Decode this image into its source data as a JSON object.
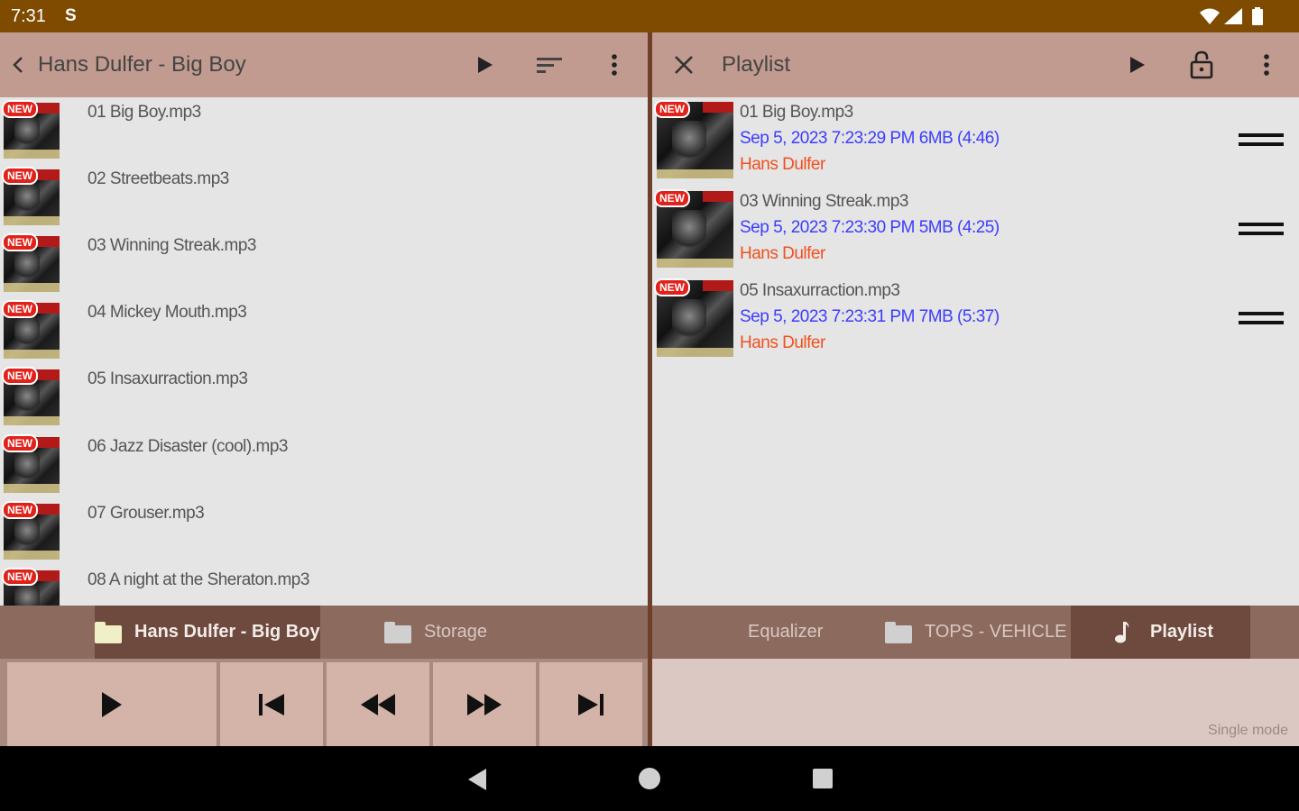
{
  "status_bar": {
    "time": "7:31",
    "sync_glyph": "S"
  },
  "left_pane": {
    "title": "Hans Dulfer - Big Boy",
    "files": [
      {
        "name": "01 Big Boy.mp3",
        "badge": "NEW"
      },
      {
        "name": "02 Streetbeats.mp3",
        "badge": "NEW"
      },
      {
        "name": "03 Winning Streak.mp3",
        "badge": "NEW"
      },
      {
        "name": "04 Mickey Mouth.mp3",
        "badge": "NEW"
      },
      {
        "name": "05 Insaxurraction.mp3",
        "badge": "NEW"
      },
      {
        "name": "06 Jazz Disaster (cool).mp3",
        "badge": "NEW"
      },
      {
        "name": "07 Grouser.mp3",
        "badge": "NEW"
      },
      {
        "name": "08 A night at the Sheraton.mp3",
        "badge": "NEW"
      }
    ],
    "tabs": [
      {
        "label": "Hans Dulfer - Big Boy",
        "active": true
      },
      {
        "label": "Storage",
        "active": false
      }
    ]
  },
  "right_pane": {
    "title": "Playlist",
    "items": [
      {
        "title": "01 Big Boy.mp3",
        "details": "Sep 5, 2023 7:23:29 PM 6MB (4:46)",
        "artist": "Hans Dulfer",
        "badge": "NEW"
      },
      {
        "title": "03 Winning Streak.mp3",
        "details": "Sep 5, 2023 7:23:30 PM 5MB (4:25)",
        "artist": "Hans Dulfer",
        "badge": "NEW"
      },
      {
        "title": "05 Insaxurraction.mp3",
        "details": "Sep 5, 2023 7:23:31 PM 7MB (5:37)",
        "artist": "Hans Dulfer",
        "badge": "NEW"
      }
    ],
    "tabs": [
      {
        "label": "Equalizer",
        "active": false
      },
      {
        "label": "TOPS - VEHICLE",
        "active": false
      },
      {
        "label": "Playlist",
        "active": true
      }
    ]
  },
  "player": {
    "mode_label": "Single mode"
  },
  "colors": {
    "status_bar": "#7e4b00",
    "toolbar": "#c19b8f",
    "tab_bar": "#8c6a5e",
    "tab_active": "#6e4a3e",
    "details_text": "#3c3cff",
    "artist_text": "#f0501e",
    "new_badge": "#e0221b"
  }
}
